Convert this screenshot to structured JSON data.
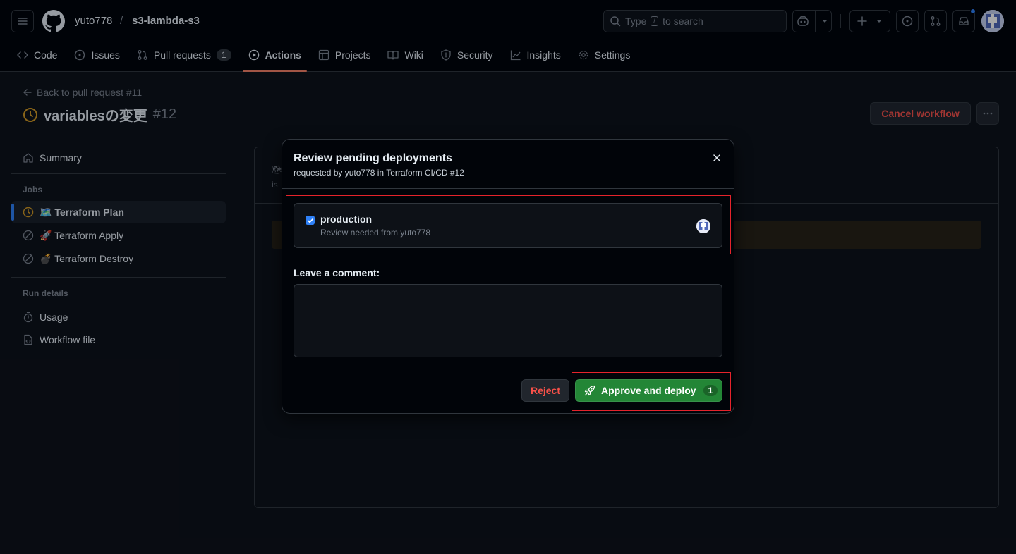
{
  "header": {
    "owner": "yuto778",
    "separator": "/",
    "repo": "s3-lambda-s3",
    "search_prefix": "Type",
    "search_key": "/",
    "search_suffix": "to search"
  },
  "tabs": [
    {
      "label": "Code",
      "icon": "code-icon"
    },
    {
      "label": "Issues",
      "icon": "issue-icon"
    },
    {
      "label": "Pull requests",
      "icon": "pull-request-icon",
      "count": "1"
    },
    {
      "label": "Actions",
      "icon": "play-icon",
      "active": true
    },
    {
      "label": "Projects",
      "icon": "table-icon"
    },
    {
      "label": "Wiki",
      "icon": "book-icon"
    },
    {
      "label": "Security",
      "icon": "shield-icon"
    },
    {
      "label": "Insights",
      "icon": "graph-icon"
    },
    {
      "label": "Settings",
      "icon": "gear-icon"
    }
  ],
  "run": {
    "back_label": "Back to pull request #11",
    "title": "variablesの変更",
    "number": "#12",
    "cancel_label": "Cancel workflow"
  },
  "sidebar": {
    "summary_label": "Summary",
    "jobs_heading": "Jobs",
    "jobs": [
      {
        "label": "🗺️ Terraform Plan",
        "status": "pending",
        "active": true
      },
      {
        "label": "🚀 Terraform Apply",
        "status": "skipped"
      },
      {
        "label": "💣 Terraform Destroy",
        "status": "skipped"
      }
    ],
    "run_details_heading": "Run details",
    "usage_label": "Usage",
    "workflow_file_label": "Workflow file"
  },
  "main": {
    "header_icon_char": "🗺",
    "header_sub_fragment": "is"
  },
  "modal": {
    "title": "Review pending deployments",
    "subtitle": "requested by yuto778 in Terraform CI/CD #12",
    "environment": {
      "name": "production",
      "checked": true,
      "review_text": "Review needed from yuto778"
    },
    "comment_label": "Leave a comment:",
    "comment_value": "",
    "reject_label": "Reject",
    "approve_label": "Approve and deploy",
    "approve_count": "1"
  },
  "colors": {
    "accent": "#2f81f7",
    "danger": "#f85149",
    "success": "#238636",
    "pending": "#d29922",
    "highlight": "#e5232b"
  }
}
